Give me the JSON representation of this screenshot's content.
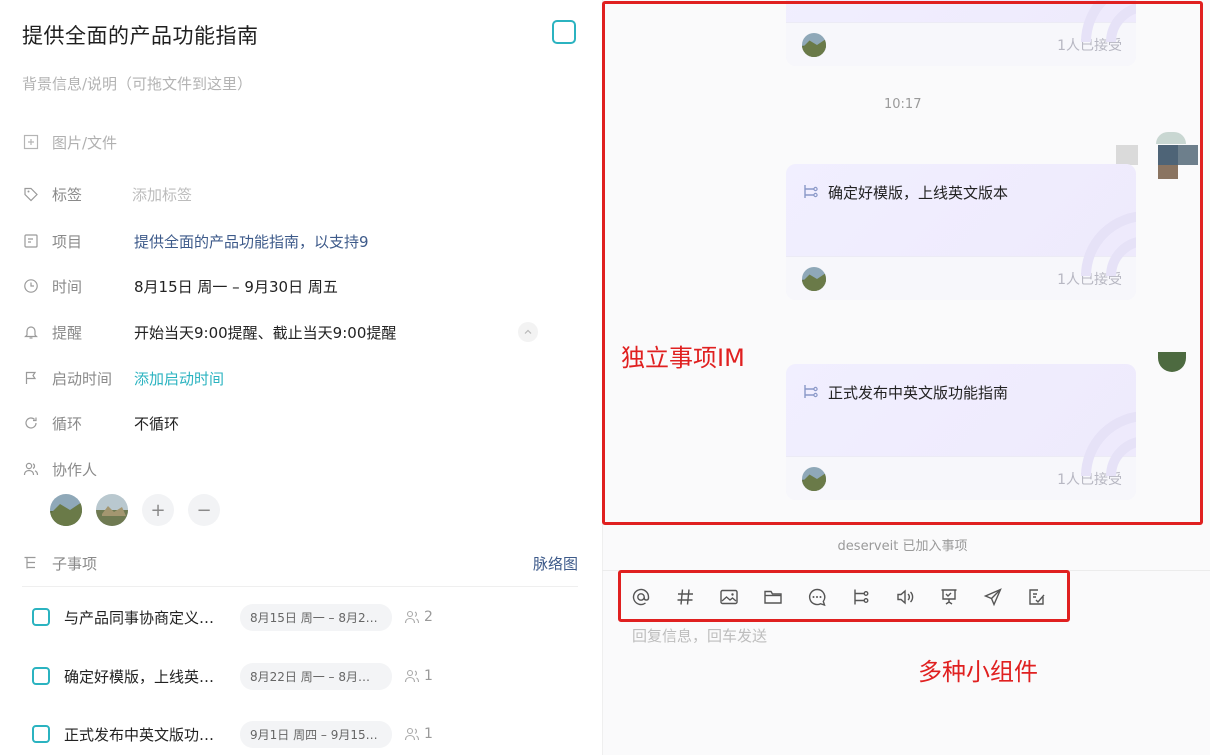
{
  "left": {
    "title": "提供全面的产品功能指南",
    "description_placeholder": "背景信息/说明（可拖文件到这里）",
    "attachment_label": "图片/文件",
    "fields": {
      "tag": {
        "label": "标签",
        "value": "添加标签"
      },
      "project": {
        "label": "项目",
        "value": "提供全面的产品功能指南，以支持9"
      },
      "time": {
        "label": "时间",
        "value": "8月15日 周一 – 9月30日 周五"
      },
      "reminder": {
        "label": "提醒",
        "value": "开始当天9:00提醒、截止当天9:00提醒"
      },
      "start_time": {
        "label": "启动时间",
        "value": "添加启动时间"
      },
      "repeat": {
        "label": "循环",
        "value": "不循环"
      },
      "collaborators": {
        "label": "协作人"
      }
    },
    "subtasks": {
      "label": "子事项",
      "graph_link": "脉络图",
      "items": [
        {
          "name": "与产品同事协商定义…",
          "date": "8月15日 周一 – 8月2…",
          "count": "2"
        },
        {
          "name": "确定好模版，上线英…",
          "date": "8月22日 周一 – 8月…",
          "count": "1"
        },
        {
          "name": "正式发布中英文版功…",
          "date": "9月1日 周四 – 9月15…",
          "count": "1"
        }
      ]
    },
    "icons": {
      "attachment": "plus-square-icon",
      "tag": "tag-icon",
      "project": "folder-icon",
      "time": "clock-icon",
      "reminder": "bell-icon",
      "start_time": "flag-icon",
      "repeat": "refresh-icon",
      "collaborators": "users-icon",
      "subtasks": "tree-icon"
    }
  },
  "right": {
    "timestamp": "10:17",
    "cards": [
      {
        "text": "",
        "accept": "1人已接受"
      },
      {
        "text": "确定好模版，上线英文版本",
        "accept": "1人已接受"
      },
      {
        "text": "正式发布中英文版功能指南",
        "accept": "1人已接受"
      }
    ],
    "annotation_im": "独立事项IM",
    "joined_notice": "deserveit 已加入事项",
    "toolbar_icons": [
      "at-icon",
      "hashtag-icon",
      "image-icon",
      "folder-icon",
      "chat-bubble-icon",
      "subtask-icon",
      "voice-icon",
      "presentation-icon",
      "send-icon",
      "task-check-icon"
    ],
    "reply_placeholder": "回复信息，回车发送",
    "annotation_widgets": "多种小组件"
  },
  "colors": {
    "accent": "#2bb3c0",
    "link": "#3d5a8a",
    "annotation_red": "#e02020",
    "card_bg": "#f1f0fb"
  }
}
